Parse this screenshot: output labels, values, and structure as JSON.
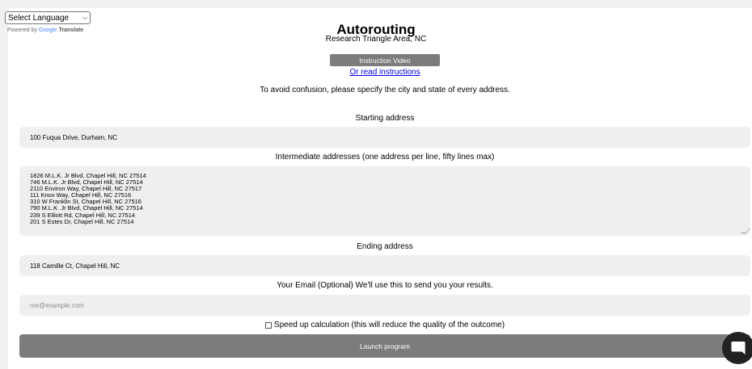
{
  "translate": {
    "select_label": "Select Language",
    "powered_by": "Powered by",
    "google": "Google",
    "translate": "Translate"
  },
  "header": {
    "title": "Autorouting",
    "subtitle": "Research Triangle Area, NC"
  },
  "instructions": {
    "video_button": "Instruction Video",
    "read_link": "Or read instructions",
    "notice": "To avoid confusion, please specify the city and state of every address."
  },
  "form": {
    "start_label": "Starting address",
    "start_value": "100 Fuqua Drive, Durham, NC",
    "intermediate_label": "Intermediate addresses (one address per line, fifty lines max)",
    "intermediate_lines": [
      "1826 M.L.K. Jr Blvd, Chapel Hill, NC 27514",
      "746 M.L.K. Jr Blvd, Chapel Hill, NC 27514",
      "2110 Environ Way, Chapel Hill, NC 27517",
      "111 Knox Way, Chapel Hill, NC 27516",
      "310 W Franklin St, Chapel Hill, NC 27516",
      "790 M.L.K. Jr Blvd, Chapel Hill, NC 27514",
      "239 S Elliott Rd, Chapel Hill, NC 27514",
      "201 S Estes Dr, Chapel Hill, NC 27514"
    ],
    "end_label": "Ending address",
    "end_value": "118 Camille Ct, Chapel Hill, NC",
    "email_label": "Your Email (Optional) We'll use this to send you your results.",
    "email_placeholder": "me@example.com",
    "speed_label": "Speed up calculation (this will reduce the quality of the outcome)",
    "speed_checked": false,
    "launch_button": "Launch program"
  },
  "chat": {
    "icon": "chat-bubble-icon"
  }
}
